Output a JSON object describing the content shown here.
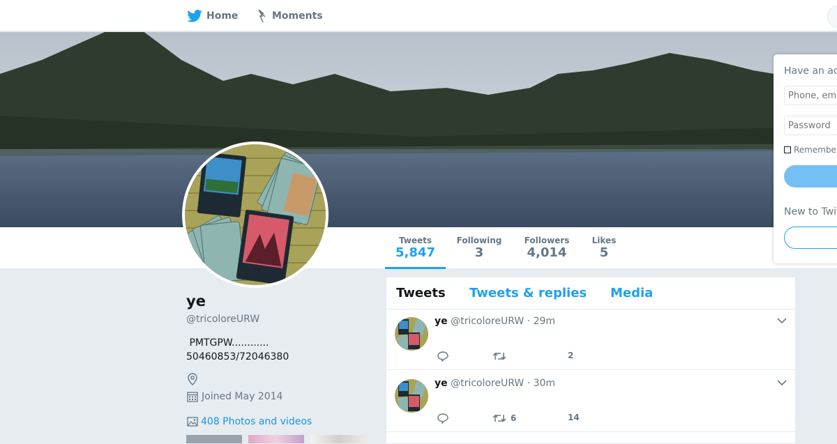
{
  "nav": {
    "home_label": "Home",
    "moments_label": "Moments"
  },
  "stats": [
    {
      "label": "Tweets",
      "value": "5,847"
    },
    {
      "label": "Following",
      "value": "3"
    },
    {
      "label": "Followers",
      "value": "4,014"
    },
    {
      "label": "Likes",
      "value": "5"
    }
  ],
  "profile": {
    "name": "ye",
    "handle": "@tricoloreURW",
    "bio": " PMTGPW............\n50460853/72046380",
    "joined": "Joined May 2014",
    "photos_link": "408 Photos and videos"
  },
  "timeline": {
    "tabs": [
      "Tweets",
      "Tweets & replies",
      "Media"
    ],
    "tweets": [
      {
        "name": "ye",
        "handle": "@tricoloreURW",
        "time": "· 29m",
        "retweets": "",
        "likes": "2"
      },
      {
        "name": "ye",
        "handle": "@tricoloreURW",
        "time": "· 30m",
        "retweets": "6",
        "likes": "14"
      }
    ]
  },
  "login": {
    "header": "Have an account?",
    "phone_placeholder": "Phone, email or username",
    "password_placeholder": "Password",
    "remember": "Remember me",
    "new_to_twitter": "New to Twitter?"
  },
  "colors": {
    "accent": "#1da1f2",
    "background": "#e6ecf0"
  }
}
